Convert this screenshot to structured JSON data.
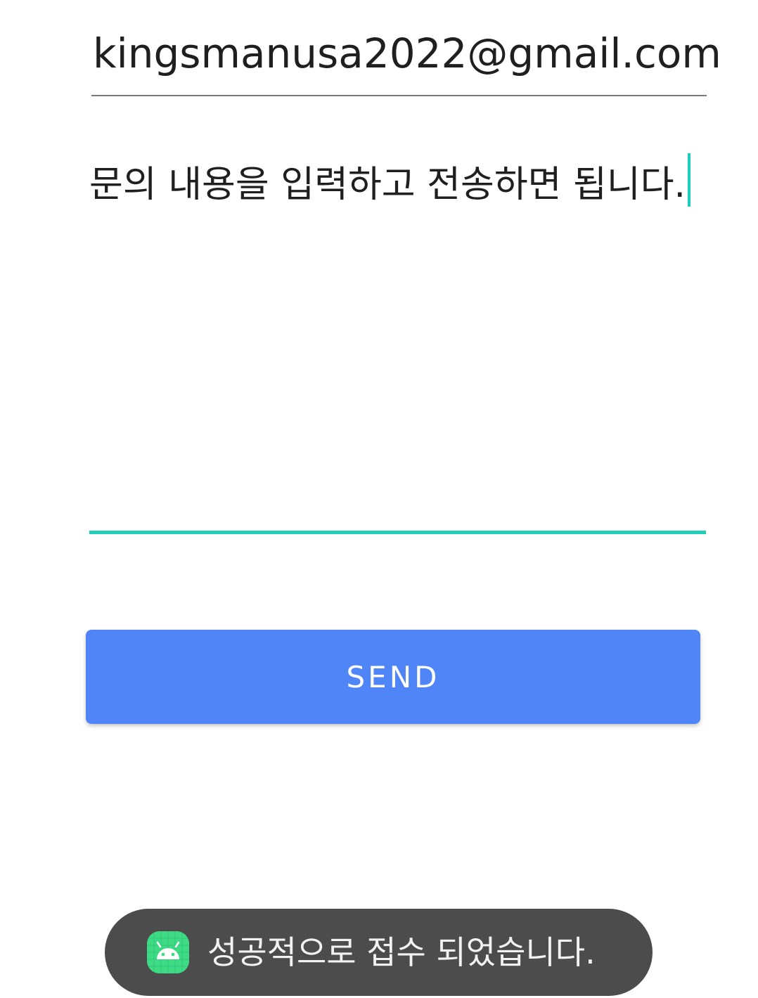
{
  "form": {
    "email_value": "kingsmanusa2022@gmail.com",
    "message_value": "문의 내용을 입력하고 전송하면 됩니다.",
    "send_label": "SEND"
  },
  "toast": {
    "icon": "android-icon",
    "message": "성공적으로 접수 되었습니다."
  },
  "colors": {
    "accent": "#1fcdb9",
    "button": "#5085f7",
    "toast_bg": "#4c4c4c",
    "android_green": "#3ddc84"
  }
}
